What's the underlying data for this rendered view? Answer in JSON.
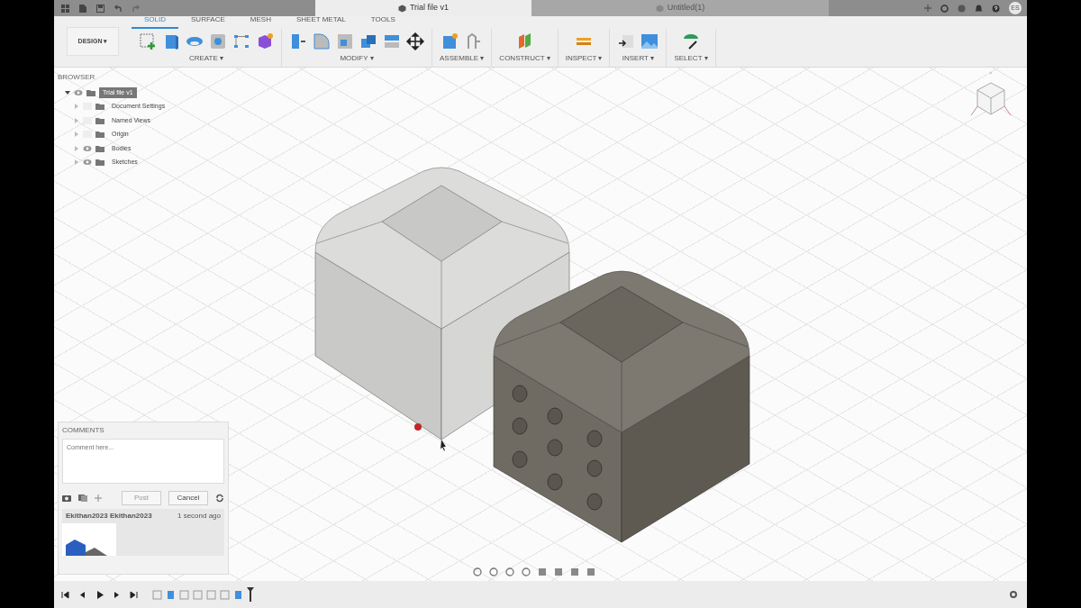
{
  "document_tabs": [
    {
      "title": "Trial file v1",
      "selected": true
    },
    {
      "title": "Untitled(1)",
      "selected": false
    }
  ],
  "user_initials": "ES",
  "workspace": "DESIGN ▾",
  "ribbon_tabs": [
    {
      "label": "SOLID",
      "selected": true
    },
    {
      "label": "SURFACE",
      "selected": false
    },
    {
      "label": "MESH",
      "selected": false
    },
    {
      "label": "SHEET METAL",
      "selected": false
    },
    {
      "label": "TOOLS",
      "selected": false
    }
  ],
  "tool_groups": [
    {
      "label": "CREATE ▾"
    },
    {
      "label": "MODIFY ▾"
    },
    {
      "label": "ASSEMBLE ▾"
    },
    {
      "label": "CONSTRUCT ▾"
    },
    {
      "label": "INSPECT ▾"
    },
    {
      "label": "INSERT ▾"
    },
    {
      "label": "SELECT ▾"
    }
  ],
  "browser": {
    "title": "BROWSER",
    "items": [
      {
        "label": "Trial file v1",
        "visible": true,
        "selected": true,
        "expanded": true,
        "children": [
          {
            "label": "Document Settings",
            "visible": false,
            "selected": false,
            "expanded": false
          },
          {
            "label": "Named Views",
            "visible": false,
            "selected": false,
            "expanded": false
          },
          {
            "label": "Origin",
            "visible": false,
            "selected": false,
            "expanded": false
          },
          {
            "label": "Bodies",
            "visible": true,
            "selected": false,
            "expanded": false
          },
          {
            "label": "Sketches",
            "visible": true,
            "selected": false,
            "expanded": false
          }
        ]
      }
    ]
  },
  "comments": {
    "title": "COMMENTS",
    "placeholder": "Comment here...",
    "buttons": [
      {
        "label": "Post",
        "disabled": true
      },
      {
        "label": "Cancel",
        "disabled": false
      }
    ],
    "entries": [
      {
        "author": "Ekithan2023 Ekithan2023",
        "time": "1 second ago"
      }
    ]
  }
}
